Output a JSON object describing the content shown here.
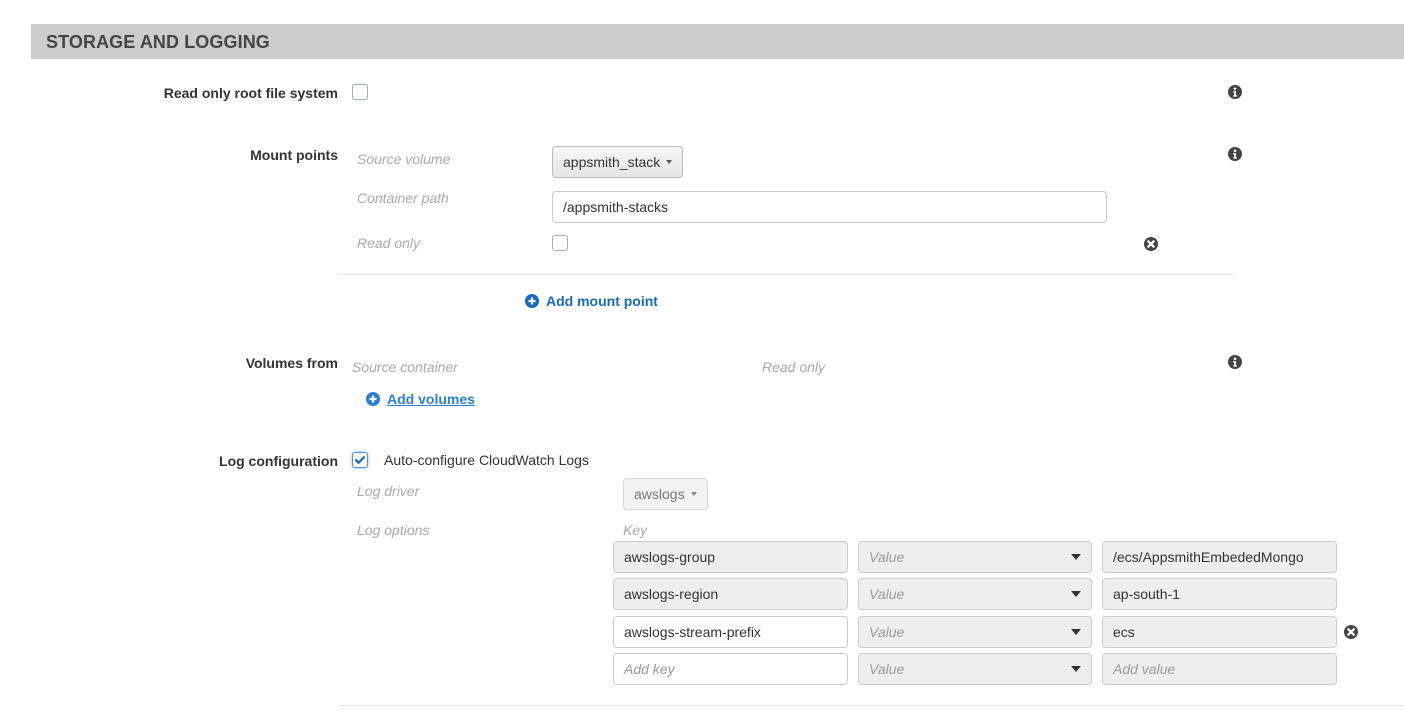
{
  "section": {
    "title": "STORAGE AND LOGGING"
  },
  "read_only_root": {
    "label": "Read only root file system",
    "checked": false
  },
  "mount_points": {
    "label": "Mount points",
    "source_volume_label": "Source volume",
    "source_volume_value": "appsmith_stack",
    "container_path_label": "Container path",
    "container_path_value": "/appsmith-stacks",
    "read_only_label": "Read only",
    "read_only_checked": false,
    "add_label": "Add mount point"
  },
  "volumes_from": {
    "label": "Volumes from",
    "source_container_label": "Source container",
    "read_only_label": "Read only",
    "add_label": "Add volumes"
  },
  "log_configuration": {
    "label": "Log configuration",
    "auto_configure_label": "Auto-configure CloudWatch Logs",
    "auto_configure_checked": true,
    "log_driver_label": "Log driver",
    "log_driver_value": "awslogs",
    "log_options_label": "Log options",
    "key_header": "Key",
    "options": [
      {
        "key": "awslogs-group",
        "value_type": "Value",
        "value": "/ecs/AppsmithEmbededMongo"
      },
      {
        "key": "awslogs-region",
        "value_type": "Value",
        "value": "ap-south-1"
      },
      {
        "key": "awslogs-stream-prefix",
        "value_type": "Value",
        "value": "ecs"
      }
    ],
    "new_option": {
      "key_placeholder": "Add key",
      "value_type": "Value",
      "value_placeholder": "Add value"
    }
  },
  "colors": {
    "header_bg": "#cccccc",
    "link": "#1a6bbf",
    "checkbox_checked": "#4a90e2"
  }
}
